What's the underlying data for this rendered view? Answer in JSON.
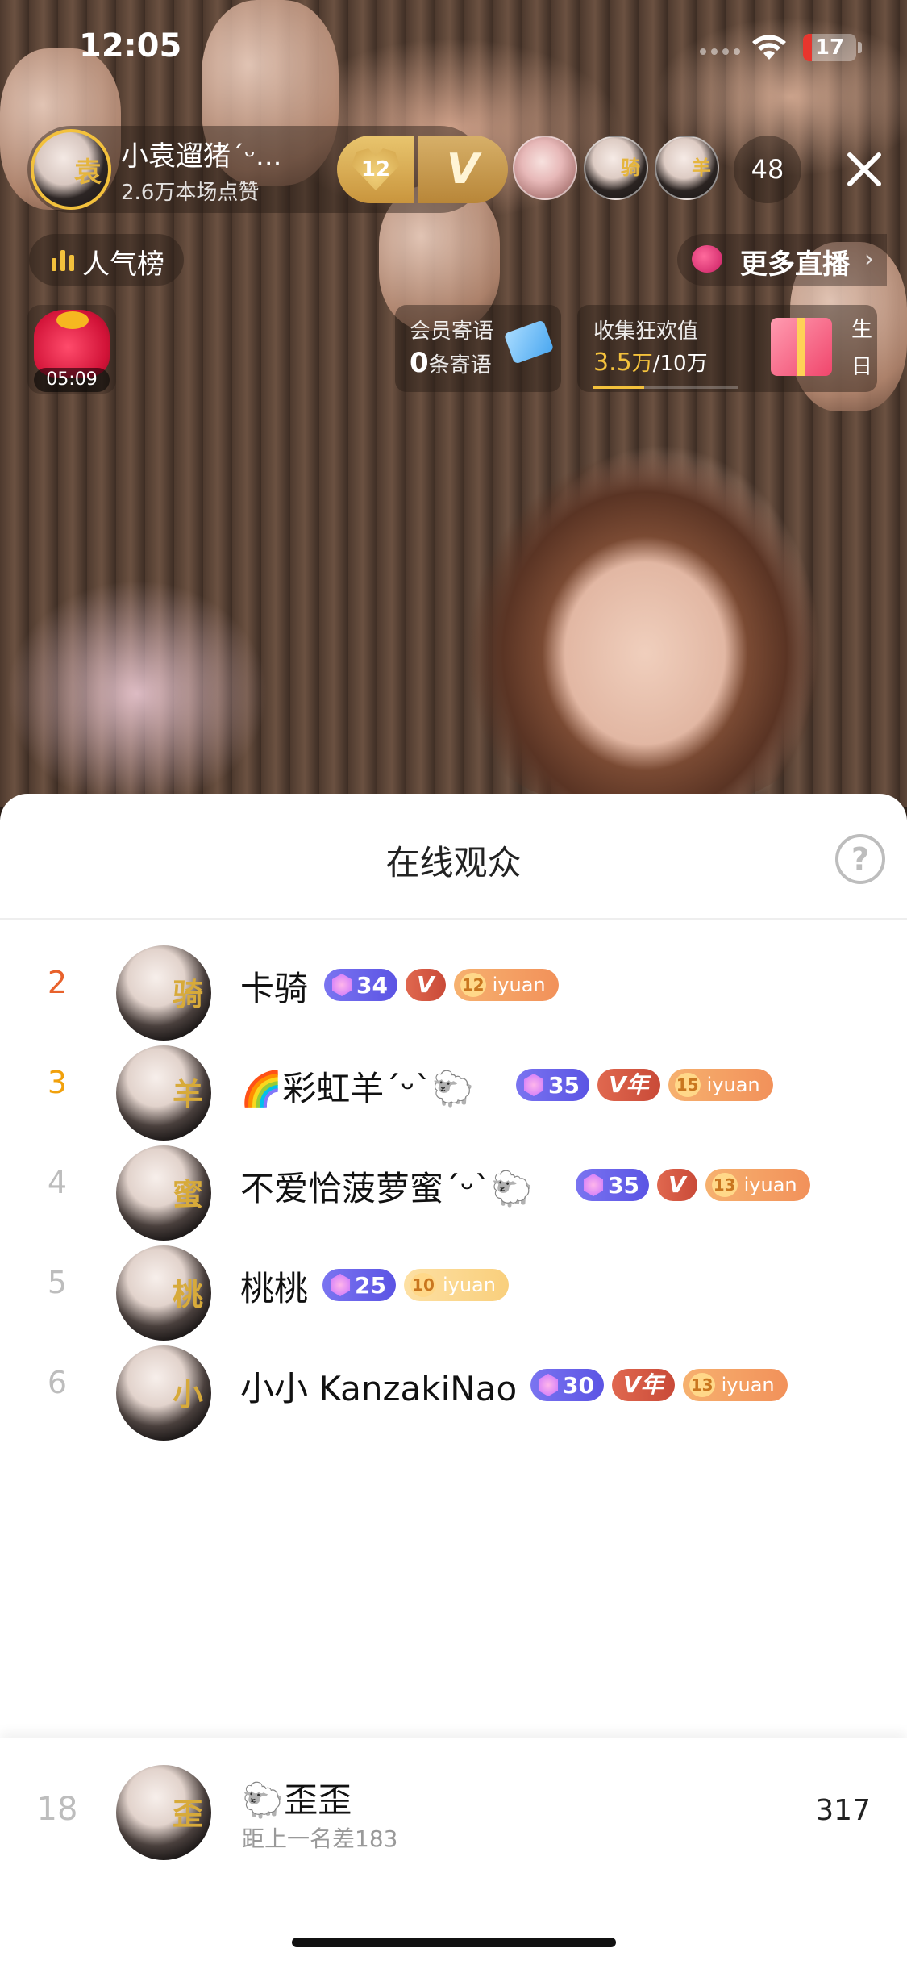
{
  "status_bar": {
    "time": "12:05",
    "battery": "17",
    "battery_level": 0.17
  },
  "host": {
    "name": "小袁遛猪´ᵕ...",
    "likes": "2.6万本场点赞",
    "heart_level": "12",
    "v_badge": "V",
    "avatar_glyph": "袁"
  },
  "viewers": {
    "avatars": [
      {
        "glyph": "",
        "icon": "avatar-pink"
      },
      {
        "glyph": "骑",
        "icon": "avatar-white"
      },
      {
        "glyph": "羊",
        "icon": "avatar-white"
      }
    ],
    "count": "48"
  },
  "rank_button": {
    "label": "人气榜"
  },
  "more_live": {
    "label": "更多直播",
    "chevron": "›"
  },
  "lucky_bag": {
    "timer": "05:09"
  },
  "member_message": {
    "title": "会员寄语",
    "count": "0",
    "suffix": "条寄语"
  },
  "collect": {
    "title": "收集狂欢值",
    "current": "3.5",
    "current_unit": "万",
    "separator": "/",
    "target": "10万",
    "progress": 0.35,
    "side_top": "生",
    "side_bottom": "日"
  },
  "sheet": {
    "title": "在线观众",
    "help": "?",
    "rows": [
      {
        "rank": "2",
        "name": "卡骑",
        "glyph": "骑",
        "level": "34",
        "v": "V",
        "fan_level": "12",
        "fan_label": "iyuan",
        "fan_pale": false
      },
      {
        "rank": "3",
        "name": "🌈彩虹羊´ᵕ`🐑",
        "glyph": "羊",
        "level": "35",
        "v": "V年",
        "fan_level": "15",
        "fan_label": "iyuan",
        "fan_pale": false
      },
      {
        "rank": "4",
        "name": "不爱恰菠萝蜜´ᵕ`🐑",
        "glyph": "蜜",
        "level": "35",
        "v": "V",
        "fan_level": "13",
        "fan_label": "iyuan",
        "fan_pale": false
      },
      {
        "rank": "5",
        "name": "桃桃",
        "glyph": "桃",
        "level": "25",
        "v": "",
        "fan_level": "10",
        "fan_label": "iyuan",
        "fan_pale": true
      },
      {
        "rank": "6",
        "name": "小小 KanzakiNao",
        "glyph": "小",
        "level": "30",
        "v": "V年",
        "fan_level": "13",
        "fan_label": "iyuan",
        "fan_pale": false
      }
    ]
  },
  "self": {
    "rank": "18",
    "name": "🐑歪歪",
    "glyph": "歪",
    "gap_text": "距上一名差183",
    "score": "317"
  },
  "colors": {
    "rank2": "#e8622c",
    "rank3": "#f1a10c",
    "gold": "#f3c13c",
    "level_badge": "#6660ea",
    "vip_badge": "#d4573f",
    "fan_badge": "#f3a064"
  }
}
